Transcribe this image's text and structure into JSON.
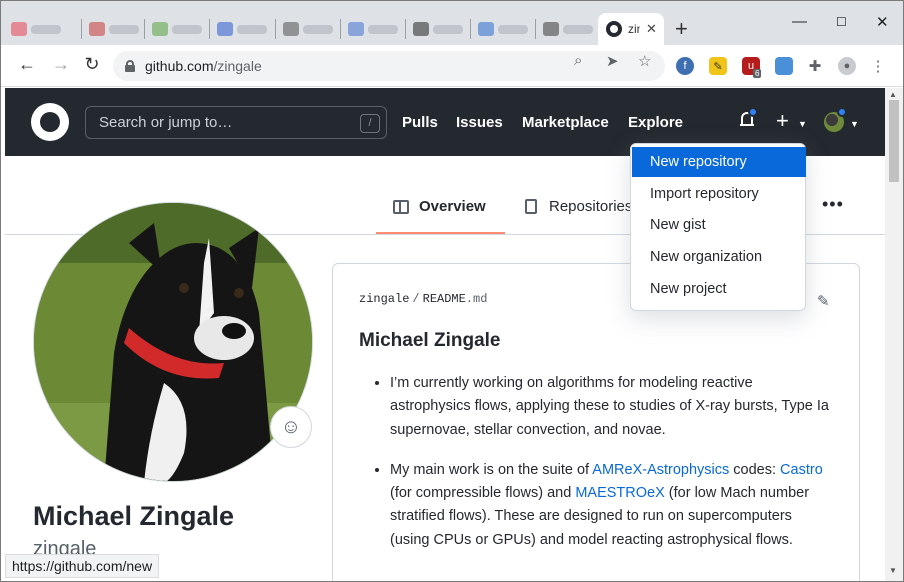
{
  "browser": {
    "active_tab_title": "zingale",
    "new_tab": "+",
    "url_domain": "github.com",
    "url_path": "/zingale",
    "ext_badge": "6",
    "status_url": "https://github.com/new"
  },
  "header": {
    "search_placeholder": "Search or jump to…",
    "search_shortcut": "/",
    "nav": [
      "Pulls",
      "Issues",
      "Marketplace",
      "Explore"
    ]
  },
  "tabs": {
    "overview": "Overview",
    "repositories": "Repositories",
    "more": "•••"
  },
  "profile": {
    "name": "Michael Zingale",
    "login": "zingale"
  },
  "readme": {
    "owner": "zingale",
    "file": "README",
    "ext": ".md",
    "title": "Michael Zingale",
    "bullet1": "I’m currently working on algorithms for modeling reactive astrophysics flows, applying these to studies of X-ray bursts, Type Ia supernovae, stellar convection, and novae.",
    "bullet2_pre": "My main work is on the suite of ",
    "bullet2_link1": "AMReX-Astrophysics",
    "bullet2_mid1": " codes: ",
    "bullet2_link2": "Castro",
    "bullet2_mid2": " (for compressible flows) and ",
    "bullet2_link3": "MAESTROeX",
    "bullet2_post": " (for low Mach number stratified flows). These are designed to run on supercomputers (using CPUs or GPUs) and model reacting astrophysical flows."
  },
  "dropdown": {
    "items": [
      "New repository",
      "Import repository",
      "New gist",
      "New organization",
      "New project"
    ],
    "active_index": 0
  },
  "colors": {
    "header_bg": "#24292f",
    "accent_blue": "#0969da",
    "tab_underline": "#fd8c73"
  }
}
